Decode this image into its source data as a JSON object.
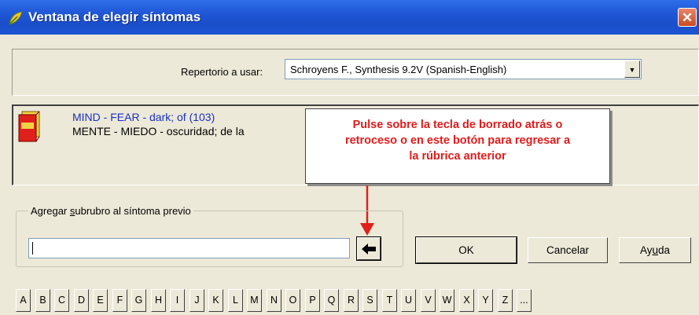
{
  "window": {
    "title": "Ventana de elegir síntomas",
    "close_glyph": "✕"
  },
  "repertory": {
    "label": "Repertorio a usar:",
    "selected": "Schroyens F., Synthesis 9.2V (Spanish-English)",
    "dropdown_glyph": "▼"
  },
  "symptom": {
    "english": "MIND - FEAR - dark; of (103)",
    "spanish": "MENTE - MIEDO - oscuridad; de la"
  },
  "callout": {
    "lines": [
      "Pulse sobre la tecla de borrado atrás o",
      "retroceso o en este botón para regresar a",
      "la rúbrica anterior"
    ]
  },
  "subrubric": {
    "group_label": "Agregar subrubro al síntoma previo",
    "group_label_parts": [
      "Agregar ",
      "s",
      "ubrubro al síntoma previo"
    ],
    "value": ""
  },
  "buttons": {
    "ok": "OK",
    "cancel": "Cancelar",
    "help_parts": [
      "Ay",
      "u",
      "da"
    ]
  },
  "alphabet": [
    "A",
    "B",
    "C",
    "D",
    "E",
    "F",
    "G",
    "H",
    "I",
    "J",
    "K",
    "L",
    "M",
    "N",
    "O",
    "P",
    "Q",
    "R",
    "S",
    "T",
    "U",
    "V",
    "W",
    "X",
    "Y",
    "Z",
    "..."
  ],
  "colors": {
    "titlebar": "#1f56d6",
    "callout_text": "#e01b1b",
    "symptom_english": "#1b2fc1"
  }
}
